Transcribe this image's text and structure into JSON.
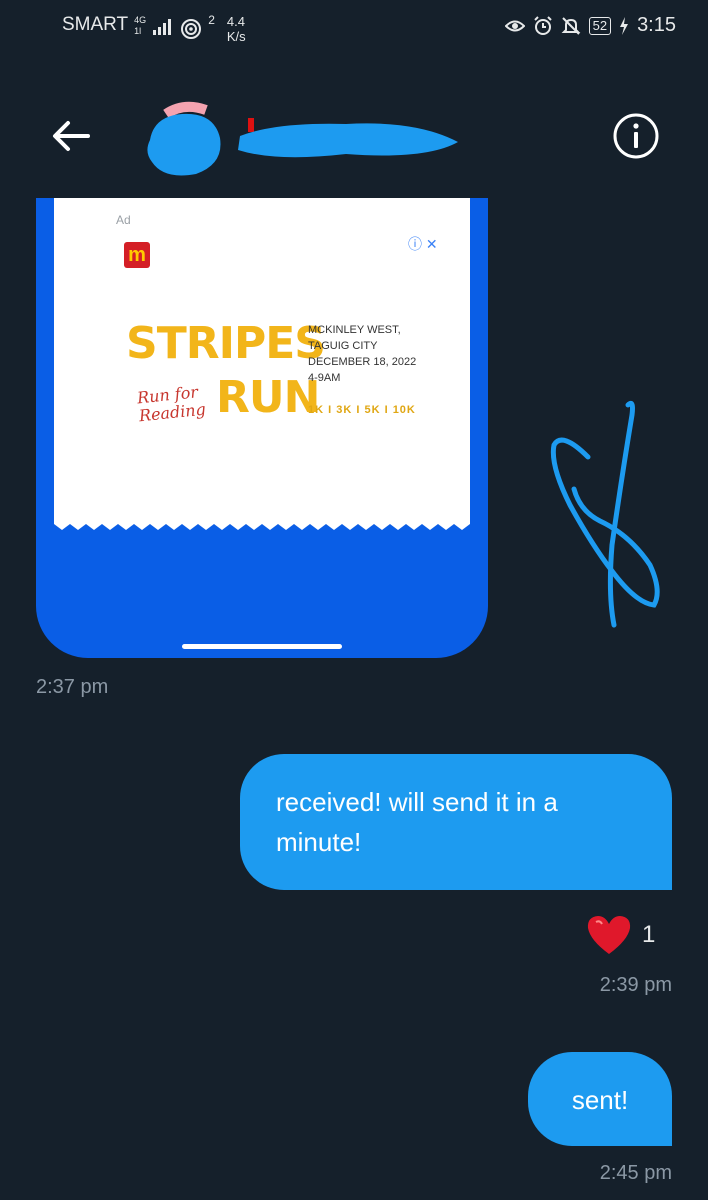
{
  "status_bar": {
    "carrier": "SMART",
    "network_type": "4G",
    "signal_sub": "1l",
    "hotspot_count": "2",
    "speed_value": "4.4",
    "speed_unit": "K/s",
    "battery": "52",
    "time": "3:15",
    "icons": [
      "eye-icon",
      "alarm-icon",
      "bell-off-icon",
      "battery-icon",
      "charging-icon"
    ]
  },
  "header": {
    "icons": [
      "back-arrow-icon",
      "info-icon"
    ]
  },
  "shared_ad": {
    "ad_label": "Ad",
    "ad_controls": "ⓘ ✕",
    "logo_letter": "m",
    "title_line1": "STRIPES",
    "title_line2": "RUN",
    "tagline_line1": "Run for",
    "tagline_line2": "Reading",
    "venue_line1": "MCKINLEY WEST,",
    "venue_line2": "TAGUIG CITY",
    "date": "DECEMBER 18, 2022",
    "hours": "4-9AM",
    "distances": "1K I 3K I 5K I 10K"
  },
  "messages": {
    "received_timestamp": "2:37 pm",
    "sent_1_text": "received! will send it in a minute!",
    "sent_1_reaction_count": "1",
    "sent_1_timestamp": "2:39 pm",
    "sent_2_text": "sent!",
    "sent_2_timestamp": "2:45 pm"
  },
  "colors": {
    "background": "#15202b",
    "bubble": "#1d9bf0",
    "redaction": "#1d9bf0",
    "media_frame": "#0a5ee6",
    "heart": "#e0182b"
  }
}
